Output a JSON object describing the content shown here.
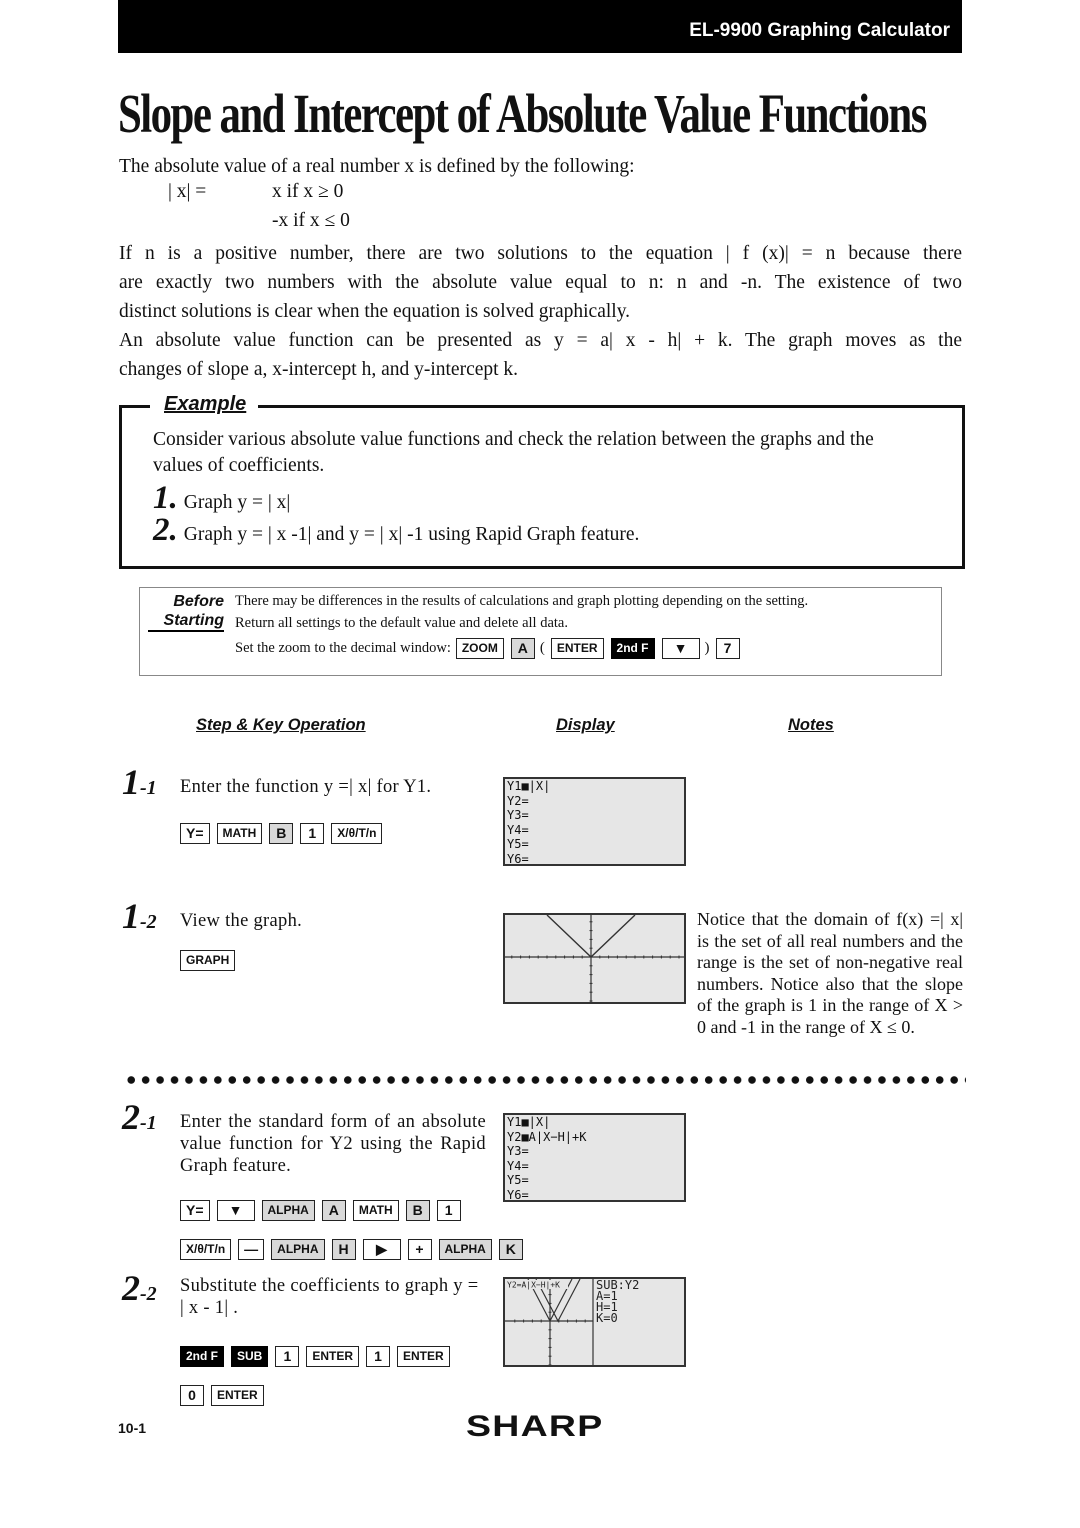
{
  "header": {
    "product": "EL-9900 Graphing Calculator"
  },
  "title": "Slope and Intercept of Absolute Value Functions",
  "intro": {
    "line1": "The absolute value of a real number x is defined by the following:",
    "def_lhs": "| x|  =",
    "def_case1": "x  if x ≥ 0",
    "def_case2": "-x  if x ≤ 0",
    "lines": [
      "If n is a positive number, there are two solutions to the equation | f (x)|  = n because there",
      "are exactly two numbers with the absolute value equal to n: n and -n. The existence of two",
      "distinct solutions is clear when the equation is solved graphically.",
      "An absolute value function can be presented as y = a| x - h|  + k. The graph moves as the",
      "changes of slope a, x-intercept h, and y-intercept k."
    ]
  },
  "example": {
    "label": "Example",
    "text": "Consider various absolute value functions and check the relation between the graphs and the values of coefficients.",
    "items": [
      {
        "num": "1.",
        "text": "Graph y = | x|"
      },
      {
        "num": "2.",
        "text": "Graph y = | x -1|  and y = | x| -1 using Rapid Graph feature."
      }
    ]
  },
  "before_starting": {
    "label_1": "Before",
    "label_2": "Starting",
    "line1": "There may be differences in the results of calculations and graph plotting depending on the setting.",
    "line2": "Return all settings to the default value and delete all data.",
    "line3": "Set the zoom to the decimal window:",
    "keys": [
      {
        "label": "ZOOM",
        "style": "plain"
      },
      {
        "label": "A",
        "style": "gray"
      },
      {
        "label": "(",
        "style": "text"
      },
      {
        "label": "ENTER",
        "style": "plain"
      },
      {
        "label": "2nd F",
        "style": "black"
      },
      {
        "label": "▼",
        "style": "plain"
      },
      {
        "label": ")",
        "style": "text"
      },
      {
        "label": "7",
        "style": "plain"
      }
    ]
  },
  "columns": {
    "step": "Step & Key Operation",
    "display": "Display",
    "notes": "Notes"
  },
  "steps": [
    {
      "num": "1",
      "sub": "-1",
      "text": "Enter the function y =| x|  for Y1.",
      "key_rows": [
        [
          {
            "label": "Y=",
            "style": "plain"
          },
          {
            "label": "MATH",
            "style": "plain"
          },
          {
            "label": "B",
            "style": "gray"
          },
          {
            "label": "1",
            "style": "plain"
          },
          {
            "label": "X/θ/T/n",
            "style": "plain"
          }
        ]
      ],
      "screen_lines": [
        "Y1■|X|",
        "Y2=",
        "Y3=",
        "Y4=",
        "Y5=",
        "Y6="
      ]
    },
    {
      "num": "1",
      "sub": "-2",
      "text": "View the graph.",
      "key_rows": [
        [
          {
            "label": "GRAPH",
            "style": "plain"
          }
        ]
      ],
      "note": "Notice that the domain of f(x) =| x|  is the set of all real numbers and the range is the set of non-negative real numbers. Notice also that the slope of the graph is 1 in the range of X > 0 and -1 in the range of X ≤ 0."
    },
    {
      "num": "2",
      "sub": "-1",
      "text": "Enter the standard form of an absolute value function for Y2 using the Rapid Graph feature.",
      "key_rows": [
        [
          {
            "label": "Y=",
            "style": "plain"
          },
          {
            "label": "▼",
            "style": "plain"
          },
          {
            "label": "ALPHA",
            "style": "gray"
          },
          {
            "label": "A",
            "style": "gray"
          },
          {
            "label": "MATH",
            "style": "plain"
          },
          {
            "label": "B",
            "style": "gray"
          },
          {
            "label": "1",
            "style": "plain"
          }
        ],
        [
          {
            "label": "X/θ/T/n",
            "style": "plain"
          },
          {
            "label": "—",
            "style": "plain"
          },
          {
            "label": "ALPHA",
            "style": "gray"
          },
          {
            "label": "H",
            "style": "gray"
          },
          {
            "label": "▶",
            "style": "plain"
          },
          {
            "label": "+",
            "style": "plain"
          },
          {
            "label": "ALPHA",
            "style": "gray"
          },
          {
            "label": "K",
            "style": "gray"
          }
        ]
      ],
      "screen_lines": [
        "Y1■|X|",
        "Y2■A|X−H|+K",
        "Y3=",
        "Y4=",
        "Y5=",
        "Y6="
      ]
    },
    {
      "num": "2",
      "sub": "-2",
      "text": "Substitute the coefficients to graph y = | x - 1| .",
      "key_rows": [
        [
          {
            "label": "2nd F",
            "style": "black"
          },
          {
            "label": "SUB",
            "style": "black"
          },
          {
            "label": "1",
            "style": "plain"
          },
          {
            "label": "ENTER",
            "style": "plain"
          },
          {
            "label": "1",
            "style": "plain"
          },
          {
            "label": "ENTER",
            "style": "plain"
          }
        ],
        [
          {
            "label": "0",
            "style": "plain"
          },
          {
            "label": "ENTER",
            "style": "plain"
          }
        ]
      ],
      "graph_header": "Y2=A|X−H|+K",
      "sub_panel": [
        "SUB:Y2",
        "A=1",
        "H=1",
        "K=0"
      ]
    }
  ],
  "footer": {
    "page": "10-1",
    "brand": "SHARP"
  }
}
